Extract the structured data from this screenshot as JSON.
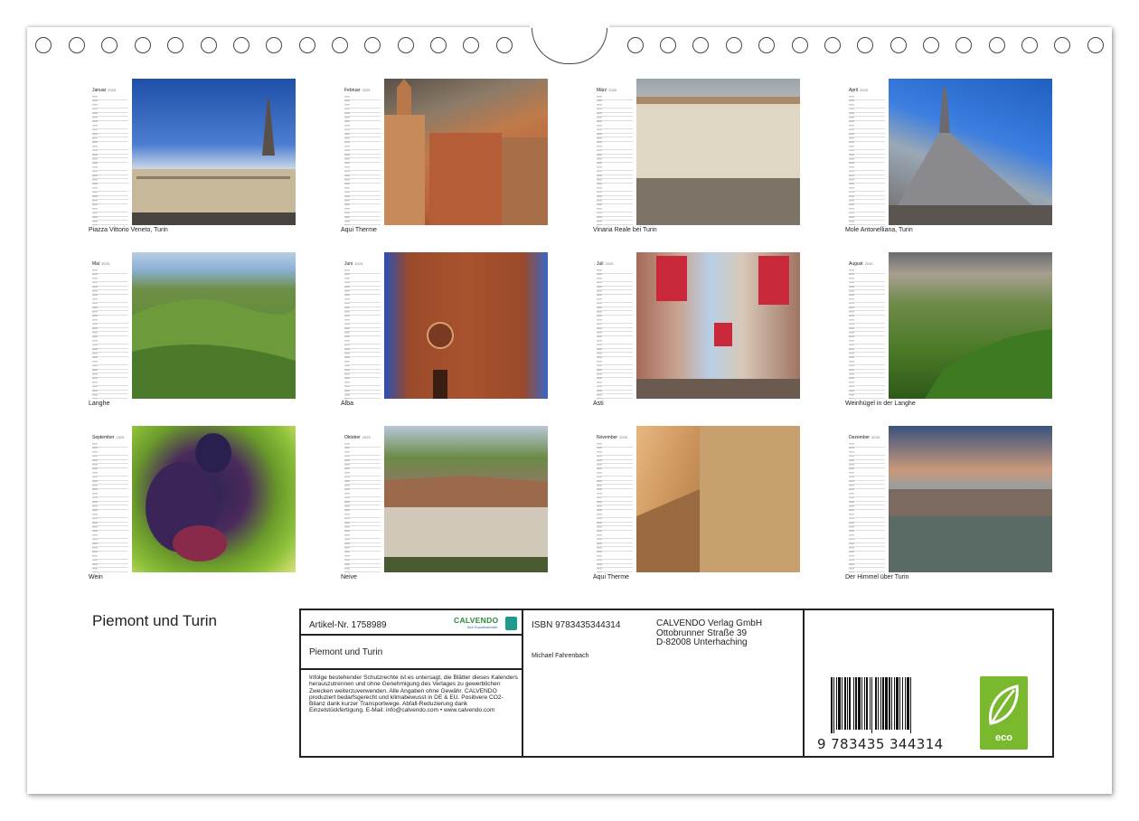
{
  "title": "Piemont und Turin",
  "months": [
    {
      "name": "Januar",
      "year": "2025",
      "caption": "Piazza Vittorio Veneto, Turin"
    },
    {
      "name": "Februar",
      "year": "2025",
      "caption": "Aqui Therme"
    },
    {
      "name": "März",
      "year": "2025",
      "caption": "Vinaria Reale bei Turin"
    },
    {
      "name": "April",
      "year": "2025",
      "caption": "Mole Antonelliana, Turin"
    },
    {
      "name": "Mai",
      "year": "2025",
      "caption": "Langhe"
    },
    {
      "name": "Juni",
      "year": "2025",
      "caption": "Alba"
    },
    {
      "name": "Juli",
      "year": "2025",
      "caption": "Asti"
    },
    {
      "name": "August",
      "year": "2025",
      "caption": "Weinhügel in der Langhe"
    },
    {
      "name": "September",
      "year": "2025",
      "caption": "Wein"
    },
    {
      "name": "Oktober",
      "year": "2025",
      "caption": "Neive"
    },
    {
      "name": "November",
      "year": "2025",
      "caption": "Aqui Therme"
    },
    {
      "name": "Dezember",
      "year": "2025",
      "caption": "Der Himmel über Turin"
    }
  ],
  "info": {
    "article": "Artikel-Nr. 1758989",
    "logo_text": "CALVENDO",
    "logo_sub": "Ihre Kunstkalender",
    "name": "Piemont und Turin",
    "legal": "Infolge bestehender Schutzrechte ist es untersagt, die Blätter dieses Kalenders herauszutrennen und ohne Genehmigung des Verlages zu gewerblichen Zwecken weiterzuverwenden. Alle Angaben ohne Gewähr. CALVENDO produziert bedarfsgerecht und klimabewusst in DE & EU. Positivere CO2-Bilanz dank kurzer Transportwege. Abfall-Reduzierung dank Einzelstückfertigung. E-Mail: info@calvendo.com • www.calvendo.com",
    "isbn": "ISBN 9783435344314",
    "publisher_line1": "CALVENDO Verlag GmbH",
    "publisher_line2": "Ottobrunner Straße 39",
    "publisher_line3": "D-82008 Unterhaching",
    "author": "Michael Fahrenbach",
    "barcode_digits": "9 783435 344314",
    "eco_label": "eco"
  }
}
